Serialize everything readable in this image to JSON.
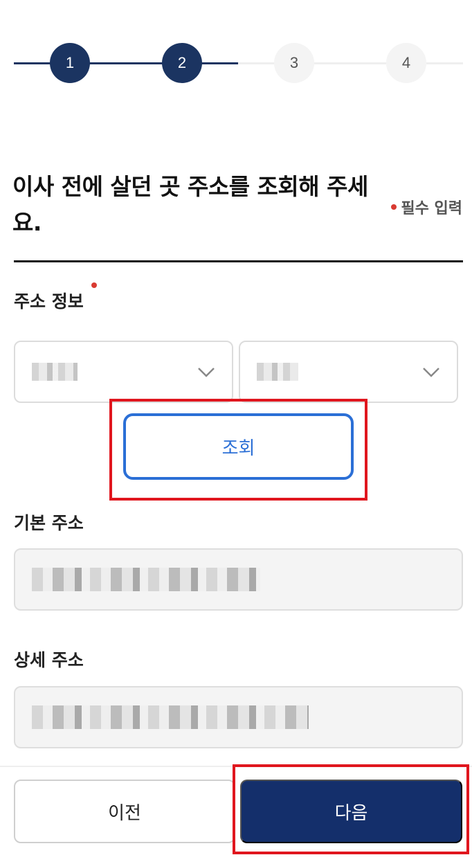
{
  "stepper": {
    "steps": [
      {
        "label": "1",
        "state": "active"
      },
      {
        "label": "2",
        "state": "active"
      },
      {
        "label": "3",
        "state": "inactive"
      },
      {
        "label": "4",
        "state": "inactive"
      }
    ],
    "current_step": 2
  },
  "heading": {
    "title": "이사 전에 살던 곳 주소를 조회해 주세요.",
    "required_note": "필수 입력"
  },
  "address_info": {
    "label": "주소 정보",
    "select_1_value": "",
    "select_2_value": "",
    "lookup_button": "조회"
  },
  "basic_address": {
    "label": "기본 주소",
    "value": ""
  },
  "detail_address": {
    "label": "상세 주소",
    "value": ""
  },
  "footer": {
    "prev_button": "이전",
    "next_button": "다음"
  },
  "colors": {
    "primary_navy": "#1b3461",
    "button_navy": "#142f6b",
    "lookup_blue": "#2b6fd6",
    "required_red": "#d93a31",
    "highlight_red": "#e0161e"
  }
}
